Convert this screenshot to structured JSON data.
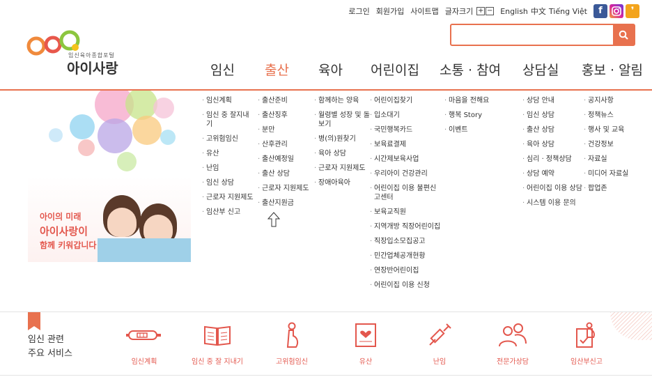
{
  "util": {
    "login": "로그인",
    "join": "회원가입",
    "sitemap": "사이트맵",
    "fontsize": "글자크기",
    "plus": "+",
    "minus": "−",
    "english": "English",
    "chinese": "中文",
    "vietnamese": "Tiếng Việt",
    "facebook": "f",
    "kakao": "❜"
  },
  "logo": {
    "sub": "임신육아종합포털",
    "name": "아이사랑"
  },
  "gnb": [
    "임신",
    "출산",
    "육아",
    "어린이집",
    "소통 · 참여",
    "상담실",
    "홍보 · 알림"
  ],
  "promo": {
    "line1": "아이의 미래",
    "line2": "아이사랑이",
    "line3": "함께 키워갑니다"
  },
  "submenu": {
    "pregnancy": [
      "임신계획",
      "임신 중 잘지내기",
      "고위험임신",
      "유산",
      "난임",
      "임신 상담",
      "근로자 지원제도",
      "임산부 신고"
    ],
    "birth": [
      "출산준비",
      "출산징후",
      "분만",
      "산후관리",
      "출산예정일",
      "출산 상담",
      "근로자 지원제도",
      "출산지원금"
    ],
    "parenting": [
      "함께하는 양육",
      "월령별 성장 및 돌보기",
      "병(의)원찾기",
      "육아 상담",
      "근로자 지원제도",
      "장애아육아"
    ],
    "daycare": [
      "어린이집찾기",
      "입소대기",
      "국민행복카드",
      "보육료결제",
      "시간제보육사업",
      "우리아이 건강관리",
      "어린이집 이용 불편신고센터",
      "보육교직원",
      "지역개방 직장어린이집",
      "직장입소모집공고",
      "민간업체공개현황",
      "연장반어린이집",
      "어린이집 이용 신청"
    ],
    "community": [
      "마음을 전해요",
      "행복 Story",
      "이벤트"
    ],
    "counsel": [
      "상담 안내",
      "임신 상담",
      "출산 상담",
      "육아 상담",
      "심리 · 정책상담",
      "상담 예약",
      "어린이집 이용 상담",
      "시스템 이용 문의"
    ],
    "news": [
      "공지사항",
      "정책뉴스",
      "행사 및 교육",
      "건강정보",
      "자료실",
      "미디어 자료실",
      "팝업존"
    ]
  },
  "services": {
    "title_line1": "임신 관련",
    "title_line2": "주요 서비스",
    "items": [
      "임신계획",
      "임신 중 잘 지내기",
      "고위험임신",
      "유산",
      "난임",
      "전문가상담",
      "임산부신고"
    ]
  },
  "colors": {
    "accent": "#e8714e",
    "label": "#e3574d"
  }
}
